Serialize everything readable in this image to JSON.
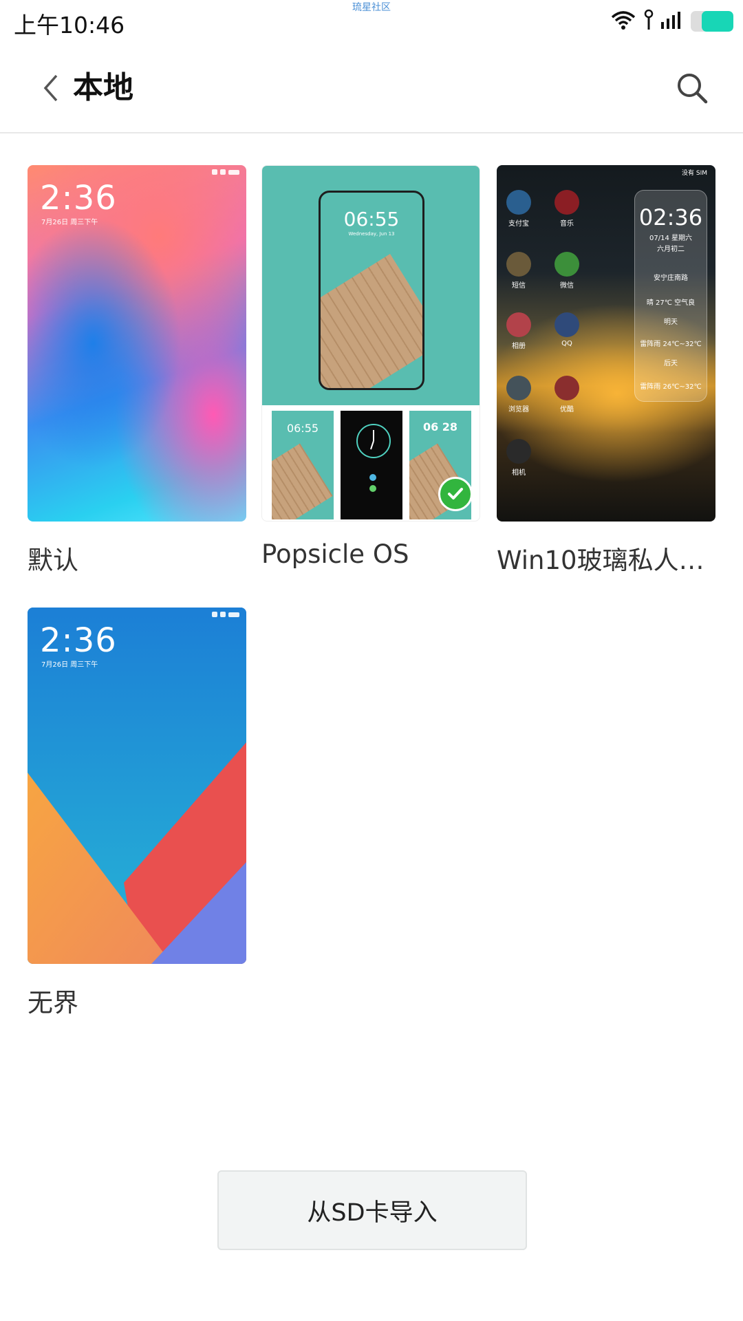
{
  "status_bar": {
    "time": "上午10:46",
    "watermark": "琉星社区",
    "battery_level": 0.75,
    "battery_color": "#18d6b6"
  },
  "header": {
    "title": "本地",
    "back_icon": "chevron-left-icon",
    "search_icon": "search-icon"
  },
  "themes": [
    {
      "name": "默认",
      "selected": false,
      "lock_time": "2:36",
      "lock_date": "7月26日 周三下午"
    },
    {
      "name": "Popsicle OS",
      "selected": true,
      "preview_time": "06:55",
      "preview_date": "Wednesday, Jun 13",
      "mini_time": "06 28"
    },
    {
      "name": "Win10玻璃私人订...",
      "selected": false,
      "widget_time": "02:36",
      "widget_date": "07/14 星期六",
      "widget_lunar": "六月初二",
      "widget_place": "安宁庄南路",
      "widget_weather_1": "晴 27℃ 空气良",
      "widget_label_2": "明天",
      "widget_weather_2": "雷阵雨 24℃~32℃",
      "widget_label_3": "后天",
      "widget_weather_3": "雷阵雨 26℃~32℃",
      "status_text": "没有 SIM",
      "apps": [
        "支付宝",
        "音乐",
        "短信",
        "微信",
        "相册",
        "QQ",
        "浏览器",
        "优酷",
        "相机"
      ]
    },
    {
      "name": "无界",
      "selected": false,
      "lock_time": "2:36",
      "lock_date": "7月26日 周三下午"
    }
  ],
  "import_button": {
    "label": "从SD卡导入"
  },
  "colors": {
    "accent_check": "#32b53e",
    "popsicle_teal": "#59bdb0"
  }
}
